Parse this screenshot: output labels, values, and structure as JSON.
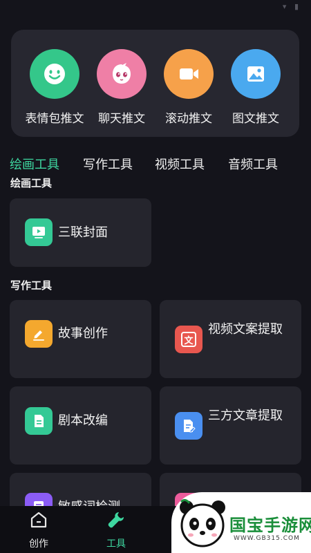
{
  "status_bar": {
    "time": "",
    "icons": "▾ ▮"
  },
  "hero": {
    "items": [
      {
        "label": "表情包推文",
        "icon": "smiley-icon",
        "color": "#34c78a"
      },
      {
        "label": "聊天推文",
        "icon": "chat-mascot-icon",
        "color": "#ef7fa6"
      },
      {
        "label": "滚动推文",
        "icon": "video-camera-icon",
        "color": "#f6a14a"
      },
      {
        "label": "图文推文",
        "icon": "image-icon",
        "color": "#4aa9ef"
      }
    ]
  },
  "tabs": [
    {
      "label": "绘画工具",
      "active": true
    },
    {
      "label": "写作工具",
      "active": false
    },
    {
      "label": "视频工具",
      "active": false
    },
    {
      "label": "音频工具",
      "active": false
    }
  ],
  "sections": {
    "painting": {
      "title": "绘画工具",
      "cards": [
        {
          "label": "三联封面",
          "icon": "play-screen-icon",
          "color": "#34c995"
        }
      ]
    },
    "writing": {
      "title": "写作工具",
      "cards": [
        {
          "label": "故事创作",
          "icon": "pencil-icon",
          "color": "#f4a82e"
        },
        {
          "label": "视频文案提取",
          "icon": "text-glyph-icon",
          "color": "#e8574f",
          "glyph": "文"
        },
        {
          "label": "剧本改编",
          "icon": "document-icon",
          "color": "#34c995"
        },
        {
          "label": "三方文章提取",
          "icon": "edit-document-icon",
          "color": "#4a8ff0"
        },
        {
          "label": "敏感词检测",
          "icon": "check-document-icon",
          "color": "#8b5cf6"
        },
        {
          "label": "",
          "icon": "pink-tool-icon",
          "color": "#ec5c9c"
        }
      ]
    }
  },
  "nav": {
    "items": [
      {
        "label": "创作",
        "icon": "home-icon",
        "active": false
      },
      {
        "label": "工具",
        "icon": "wrench-icon",
        "active": true
      }
    ],
    "active_color": "#3ed7a0"
  },
  "watermark": {
    "text": "国宝手游网",
    "url": "WWW.GB315.COM"
  }
}
